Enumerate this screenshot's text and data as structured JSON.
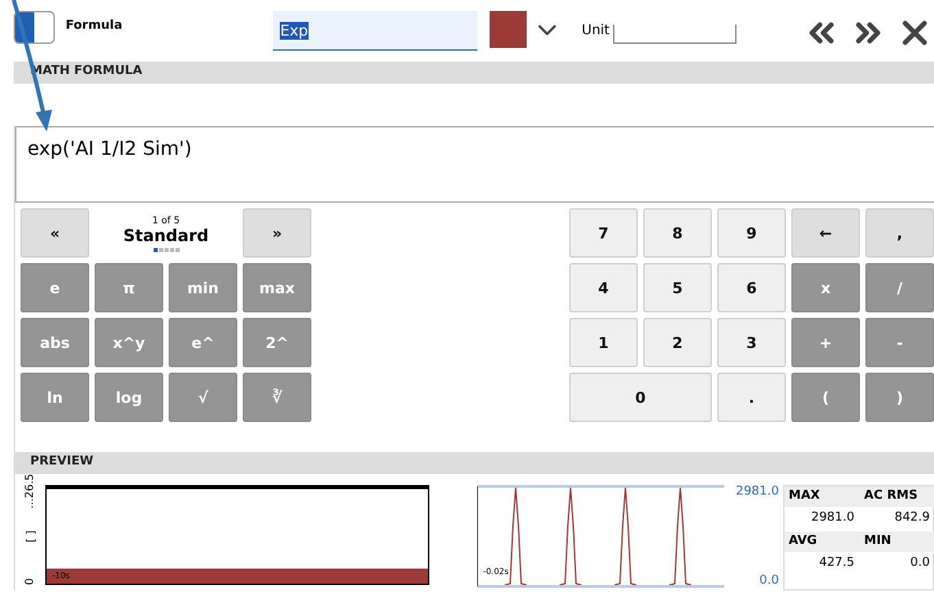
{
  "toolbar": {
    "toggle": {
      "on": true
    },
    "label": "Formula",
    "name_field": {
      "value": "Exp",
      "highlighted": true
    },
    "unit": {
      "label": "Unit"
    }
  },
  "math_formula": {
    "title": "MATH FORMULA",
    "expression": "exp('AI 1/I2 Sim')"
  },
  "function_pad": {
    "prev": "«",
    "page": "1 of 5",
    "name": "Standard",
    "next": "»",
    "pages": [
      {
        "selected": true
      },
      {
        "selected": false
      },
      {
        "selected": false
      },
      {
        "selected": false
      },
      {
        "selected": false
      }
    ],
    "keys": [
      "e",
      "π",
      "min",
      "max",
      "abs",
      "x^y",
      "e^",
      "2^",
      "ln",
      "log",
      "√",
      "∛"
    ]
  },
  "number_pad": [
    {
      "label": "7",
      "kind": "digit",
      "wide": false
    },
    {
      "label": "8",
      "kind": "digit",
      "wide": false
    },
    {
      "label": "9",
      "kind": "digit",
      "wide": false
    },
    {
      "label": "←",
      "kind": "edit",
      "wide": false
    },
    {
      "label": ",",
      "kind": "edit",
      "wide": false
    },
    {
      "label": "4",
      "kind": "digit",
      "wide": false
    },
    {
      "label": "5",
      "kind": "digit",
      "wide": false
    },
    {
      "label": "6",
      "kind": "digit",
      "wide": false
    },
    {
      "label": "x",
      "kind": "operator",
      "wide": false
    },
    {
      "label": "/",
      "kind": "operator",
      "wide": false
    },
    {
      "label": "1",
      "kind": "digit",
      "wide": false
    },
    {
      "label": "2",
      "kind": "digit",
      "wide": false
    },
    {
      "label": "3",
      "kind": "digit",
      "wide": false
    },
    {
      "label": "+",
      "kind": "operator",
      "wide": false
    },
    {
      "label": "-",
      "kind": "operator",
      "wide": false
    },
    {
      "label": "0",
      "kind": "digit",
      "wide": true
    },
    {
      "label": ".",
      "kind": "digit",
      "wide": false
    },
    {
      "label": "(",
      "kind": "operator",
      "wide": false
    },
    {
      "label": ")",
      "kind": "operator",
      "wide": false
    }
  ],
  "preview": {
    "title": "PREVIEW",
    "overview": {
      "y_max": "...26.5",
      "unit": "[ ]",
      "y_min": "0",
      "time": "-10s"
    },
    "detail": {
      "time": "-0.02s",
      "axis_max": "2981.0",
      "axis_min": "0.0"
    },
    "stats": [
      {
        "label": "MAX",
        "value": "2981.0"
      },
      {
        "label": "AC RMS",
        "value": "842.9"
      },
      {
        "label": "AVG",
        "value": "427.5"
      },
      {
        "label": "MIN",
        "value": "0.0"
      }
    ]
  }
}
